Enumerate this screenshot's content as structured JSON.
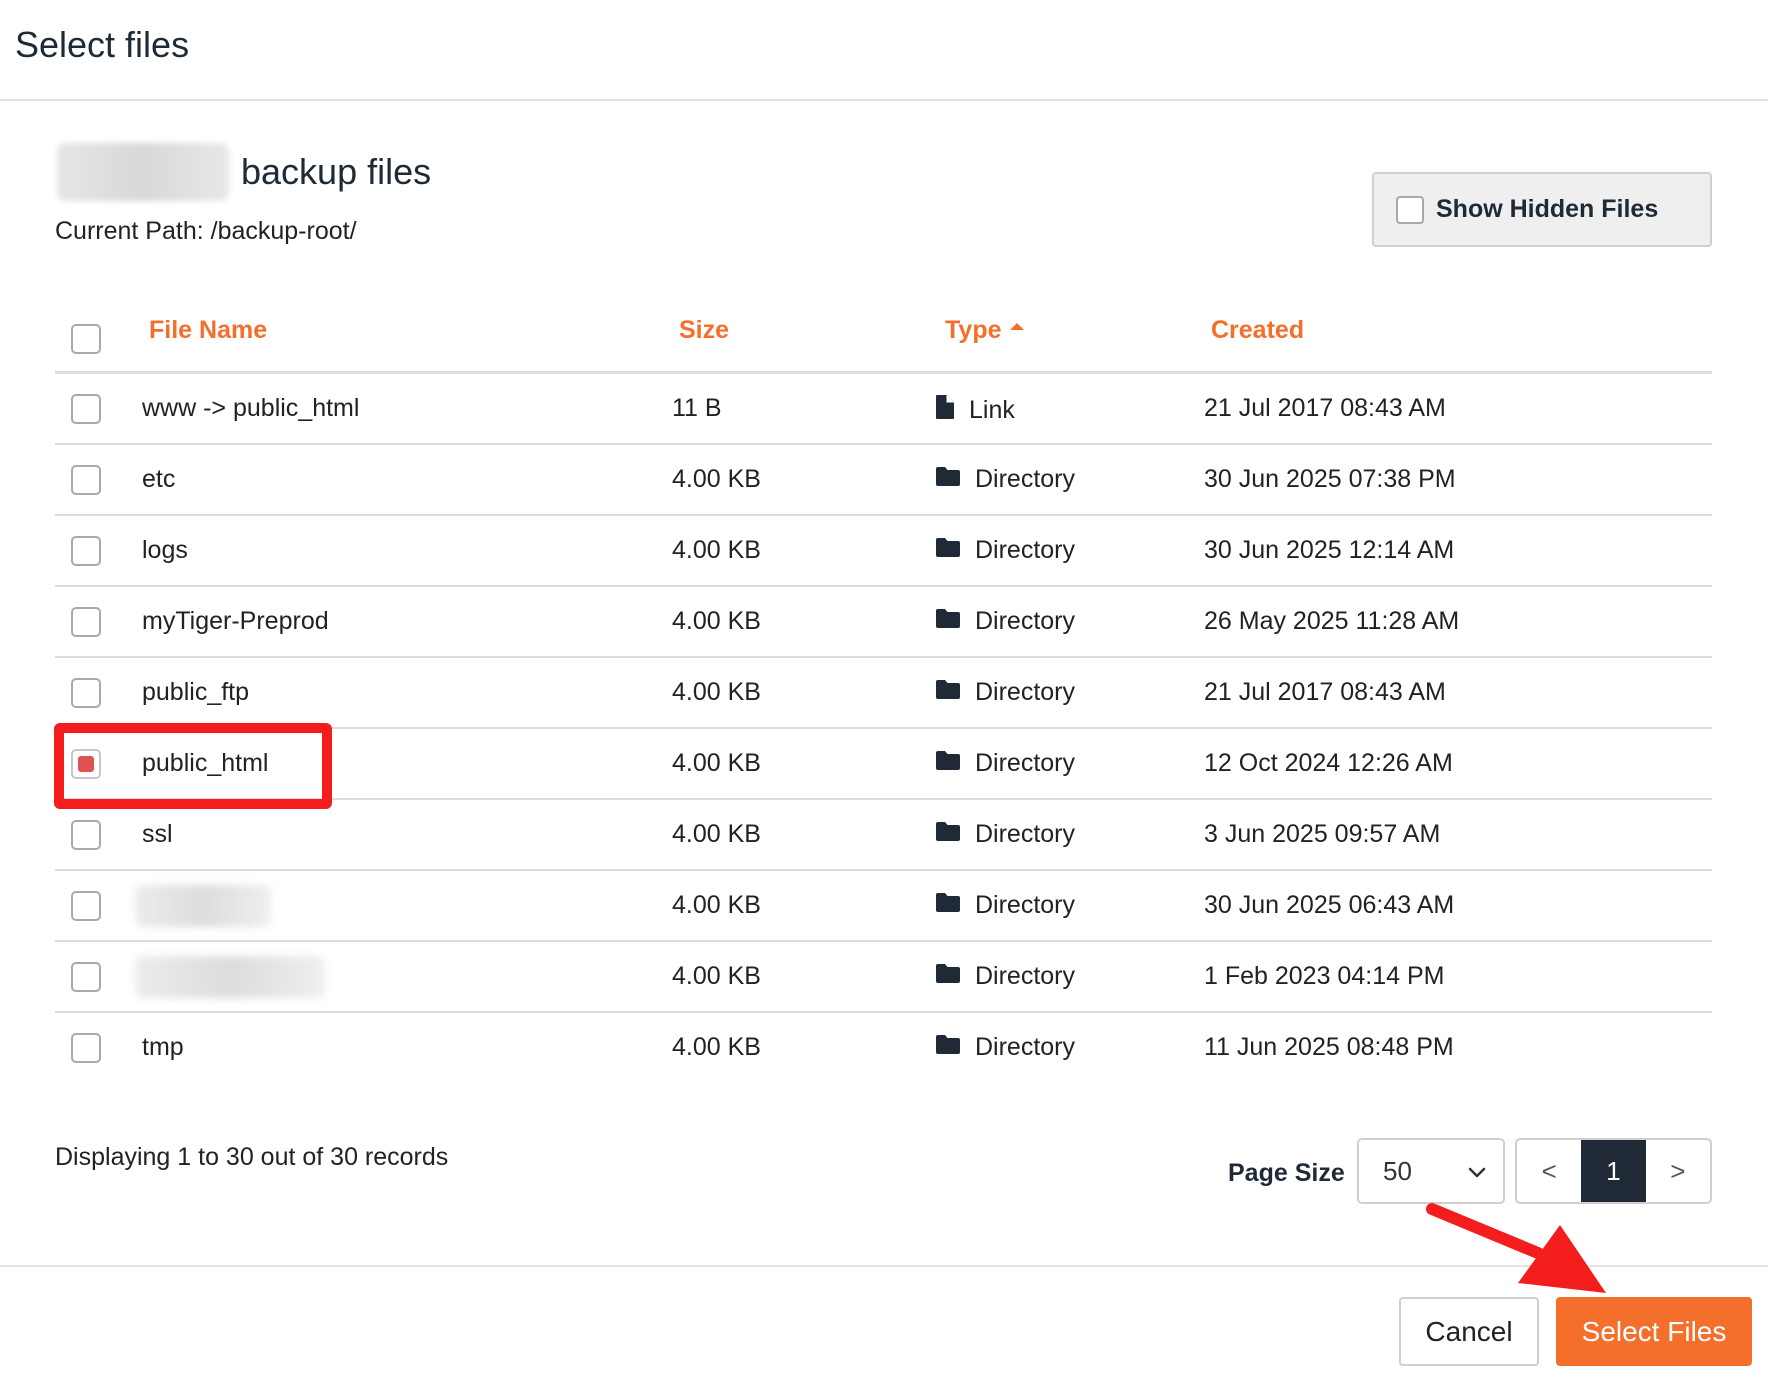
{
  "dialog": {
    "title": "Select files"
  },
  "site": {
    "title_suffix": "backup files",
    "current_path": "Current Path: /backup-root/"
  },
  "hidden_files_toggle": {
    "label": "Show Hidden Files",
    "checked": false
  },
  "table": {
    "columns": {
      "name": "File Name",
      "size": "Size",
      "type": "Type",
      "created": "Created"
    },
    "sort": {
      "column": "Type",
      "direction": "ascending"
    },
    "rows": [
      {
        "name": "www -> public_html",
        "size": "11 B",
        "type": "Link",
        "icon": "file-icon",
        "created": "21 Jul 2017 08:43 AM",
        "checked": false
      },
      {
        "name": "etc",
        "size": "4.00 KB",
        "type": "Directory",
        "icon": "folder-icon",
        "created": "30 Jun 2025 07:38 PM",
        "checked": false
      },
      {
        "name": "logs",
        "size": "4.00 KB",
        "type": "Directory",
        "icon": "folder-icon",
        "created": "30 Jun 2025 12:14 AM",
        "checked": false
      },
      {
        "name": "myTiger-Preprod",
        "size": "4.00 KB",
        "type": "Directory",
        "icon": "folder-icon",
        "created": "26 May 2025 11:28 AM",
        "checked": false
      },
      {
        "name": "public_ftp",
        "size": "4.00 KB",
        "type": "Directory",
        "icon": "folder-icon",
        "created": "21 Jul 2017 08:43 AM",
        "checked": false
      },
      {
        "name": "public_html",
        "size": "4.00 KB",
        "type": "Directory",
        "icon": "folder-icon",
        "created": "12 Oct 2024 12:26 AM",
        "checked": true
      },
      {
        "name": "ssl",
        "size": "4.00 KB",
        "type": "Directory",
        "icon": "folder-icon",
        "created": "3 Jun 2025 09:57 AM",
        "checked": false
      },
      {
        "name": "",
        "size": "4.00 KB",
        "type": "Directory",
        "icon": "folder-icon",
        "created": "30 Jun 2025 06:43 AM",
        "checked": false,
        "name_blurred": true
      },
      {
        "name": "",
        "size": "4.00 KB",
        "type": "Directory",
        "icon": "folder-icon",
        "created": "1 Feb 2023 04:14 PM",
        "checked": false,
        "name_blurred": true
      },
      {
        "name": "tmp",
        "size": "4.00 KB",
        "type": "Directory",
        "icon": "folder-icon",
        "created": "11 Jun 2025 08:48 PM",
        "checked": false
      }
    ]
  },
  "pagination": {
    "records_text": "Displaying 1 to 30 out of 30 records",
    "page_size_label": "Page Size",
    "page_size": "50",
    "prev": "<",
    "current_page": "1",
    "next": ">"
  },
  "footer": {
    "cancel_label": "Cancel",
    "select_label": "Select Files"
  },
  "colors": {
    "accent": "#f36f2b",
    "annotation_red": "#f41d1d",
    "checked_fill": "#e05252",
    "dark": "#1f2a36"
  }
}
